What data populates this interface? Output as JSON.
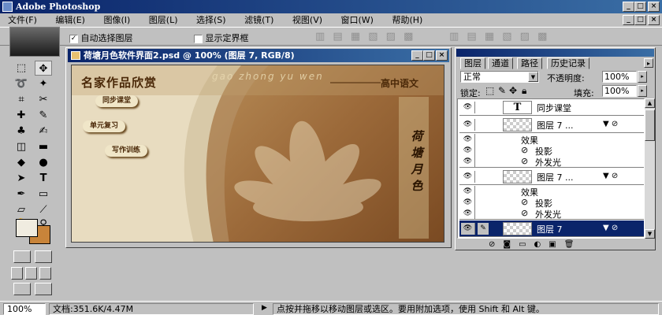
{
  "window": {
    "title": "Adobe Photoshop"
  },
  "menu": [
    "文件(F)",
    "编辑(E)",
    "图像(I)",
    "图层(L)",
    "选择(S)",
    "滤镜(T)",
    "视图(V)",
    "窗口(W)",
    "帮助(H)"
  ],
  "options": {
    "auto_select_label": "自动选择图层",
    "show_bbox_label": "显示定界框"
  },
  "document": {
    "title": "荷塘月色软件界面2.psd @ 100% (图层 7, RGB/8)"
  },
  "artwork": {
    "title": "名家作品欣赏",
    "pinyin": "gao zhong yu wen",
    "subtitle": "高中语文",
    "buttons": [
      "同步课堂",
      "单元复习",
      "写作训练"
    ],
    "vertical_title": "荷塘月色"
  },
  "layers_panel": {
    "tabs": [
      "图层",
      "通道",
      "路径",
      "历史记录"
    ],
    "blend_mode": "正常",
    "opacity_label": "不透明度:",
    "opacity_value": "100%",
    "lock_label": "锁定:",
    "fill_label": "填充:",
    "fill_value": "100%",
    "layers": [
      {
        "name": "同步课堂",
        "type": "text"
      },
      {
        "name": "图层 7 ...",
        "type": "layer"
      },
      {
        "name": "效果",
        "type": "effects"
      },
      {
        "name": "投影",
        "type": "effect"
      },
      {
        "name": "外发光",
        "type": "effect"
      },
      {
        "name": "图层 7 ...",
        "type": "layer"
      },
      {
        "name": "效果",
        "type": "effects"
      },
      {
        "name": "投影",
        "type": "effect"
      },
      {
        "name": "外发光",
        "type": "effect"
      },
      {
        "name": "图层 7",
        "type": "layer",
        "selected": true
      }
    ]
  },
  "status": {
    "zoom": "100%",
    "doc_size": "文档:351.6K/4.47M",
    "hint": "点按并拖移以移动图层或选区。要用附加选项，使用 Shift 和 Alt 键。"
  },
  "colors": {
    "foreground": "#f0ece0",
    "background": "#c8843a",
    "selection": "#0a246a"
  }
}
